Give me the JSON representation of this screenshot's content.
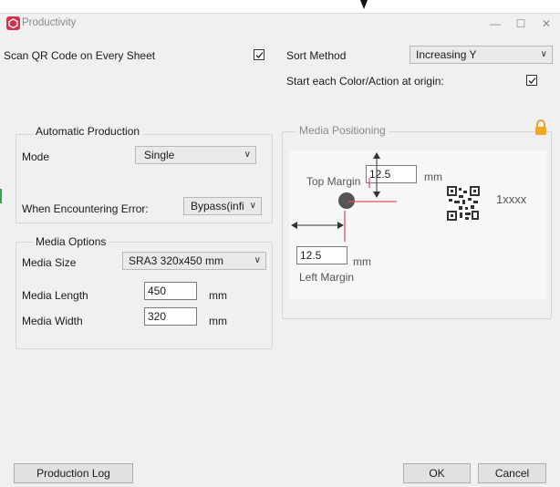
{
  "window": {
    "title": "Productivity",
    "controls": {
      "minimize": "—",
      "maximize": "☐",
      "close": "✕"
    }
  },
  "top": {
    "scan_qr_label": "Scan QR Code on Every Sheet",
    "scan_qr_checked": true,
    "sort_method_label": "Sort Method",
    "sort_method_value": "Increasing Y",
    "start_origin_label": "Start each Color/Action at origin:",
    "start_origin_checked": true
  },
  "automatic_production": {
    "title": "Automatic Production",
    "mode_label": "Mode",
    "mode_value": "Single",
    "error_label": "When Encountering Error:",
    "error_value": "Bypass(infi"
  },
  "media_options": {
    "title": "Media Options",
    "size_label": "Media Size",
    "size_value": "SRA3 320x450 mm",
    "length_label": "Media Length",
    "length_value": "450",
    "length_unit": "mm",
    "width_label": "Media Width",
    "width_value": "320",
    "width_unit": "mm"
  },
  "media_positioning": {
    "title": "Media Positioning",
    "top_margin_label": "Top Margin",
    "top_margin_value": "12.5",
    "top_margin_unit": "mm",
    "left_margin_label": "Left Margin",
    "left_margin_value": "12.5",
    "left_margin_unit": "mm",
    "qr_text": "1xxxx"
  },
  "footer": {
    "production_log_label": "Production Log",
    "ok_label": "OK",
    "cancel_label": "Cancel"
  }
}
